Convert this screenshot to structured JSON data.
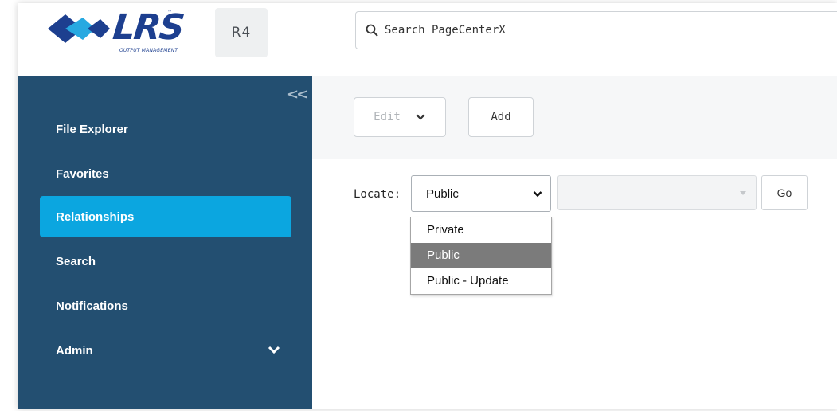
{
  "header": {
    "logo_text": "LRS",
    "logo_tm": "™",
    "logo_subtitle": "OUTPUT MANAGEMENT",
    "version_badge": "R4",
    "search_placeholder": "Search PageCenterX"
  },
  "sidebar": {
    "collapse_label": "<<",
    "items": [
      {
        "label": "File Explorer"
      },
      {
        "label": "Favorites"
      },
      {
        "label": "Relationships",
        "active": true
      },
      {
        "label": "Search"
      },
      {
        "label": "Notifications"
      },
      {
        "label": "Admin",
        "has_submenu": true
      }
    ]
  },
  "toolbar": {
    "edit_label": "Edit",
    "add_label": "Add"
  },
  "locate": {
    "label": "Locate:",
    "selected": "Public",
    "go_label": "Go",
    "options": [
      "Private",
      "Public",
      "Public - Update"
    ]
  },
  "colors": {
    "sidebar_bg": "#234f71",
    "active_item": "#0ba6e0",
    "brand_blue": "#1d3f8f",
    "brand_cyan": "#27a9e1",
    "selected_option": "#7b7b7b"
  }
}
